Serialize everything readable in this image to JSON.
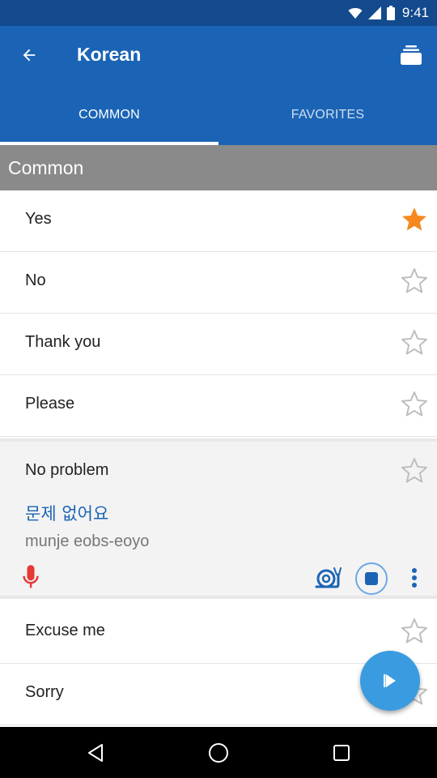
{
  "status_bar": {
    "time": "9:41"
  },
  "app_bar": {
    "title": "Korean",
    "back_icon": "arrow-back-icon",
    "menu_icon": "flashcards-icon"
  },
  "tabs": [
    {
      "label": "COMMON",
      "selected": true
    },
    {
      "label": "FAVORITES",
      "selected": false
    }
  ],
  "section": {
    "title": "Common"
  },
  "phrases": [
    {
      "label": "Yes",
      "favorite": true
    },
    {
      "label": "No",
      "favorite": false
    },
    {
      "label": "Thank you",
      "favorite": false
    },
    {
      "label": "Please",
      "favorite": false
    },
    {
      "label": "No problem",
      "favorite": false,
      "korean": "문제 없어요",
      "romanization": "munje eobs-eoyo"
    },
    {
      "label": "Excuse me",
      "favorite": false
    },
    {
      "label": "Sorry",
      "favorite": false
    }
  ],
  "colors": {
    "primary": "#1b64b5",
    "primary_dark": "#134a8e",
    "accent": "#f5891f",
    "fab": "#3a9be0",
    "mic": "#e53935"
  }
}
